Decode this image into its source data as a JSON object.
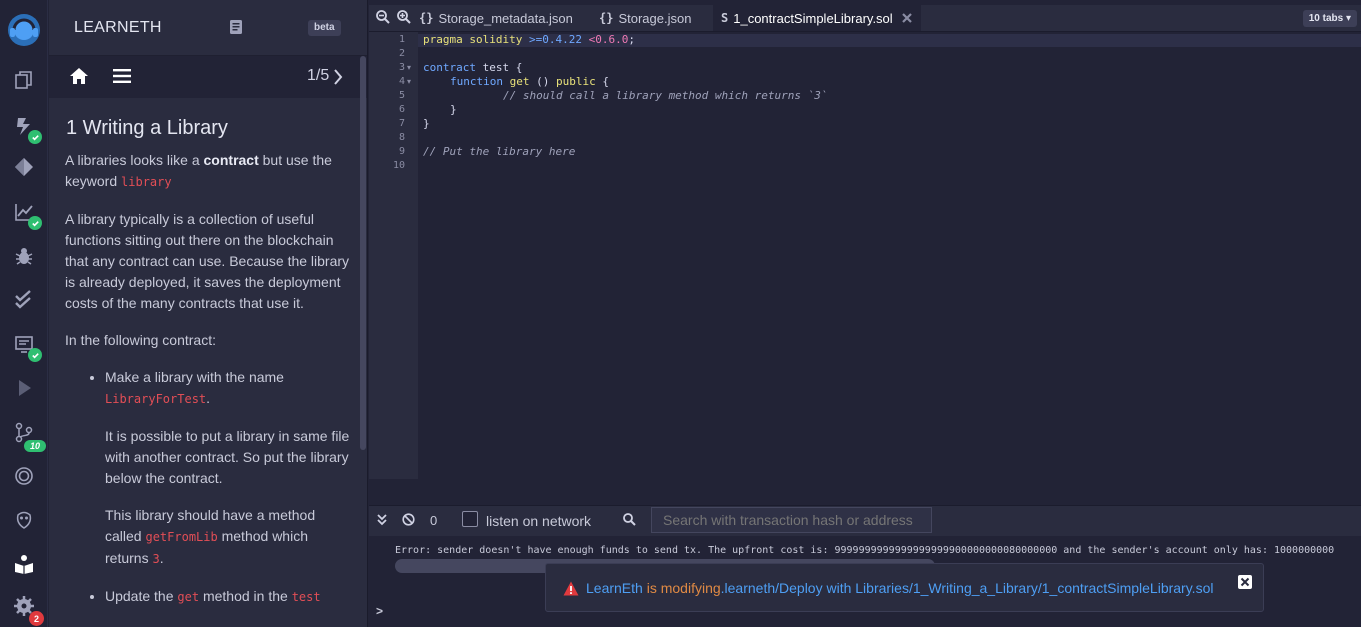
{
  "sidepanel": {
    "title": "LEARNETH",
    "beta": "beta",
    "step": "1/5",
    "heading": "1 Writing a Library",
    "p1_a": "A libraries looks like a ",
    "p1_b": "contract",
    "p1_c": " but use the keyword ",
    "p1_code": "library",
    "p2": "A library typically is a collection of useful functions sitting out there on the blockchain that any contract can use. Because the library is already deployed, it saves the deployment costs of the many contracts that use it.",
    "p3": "In the following contract:",
    "li1_a": "Make a library with the name ",
    "li1_code": "LibraryForTest",
    "li1_c": ".",
    "li1_p2": "It is possible to put a library in same file with another contract. So put the library below the contract.",
    "li1_p3_a": "This library should have a method called ",
    "li1_p3_code": "getFromLib",
    "li1_p3_c": " method which returns ",
    "li1_p3_code2": "3",
    "li1_p3_d": ".",
    "li2_a": "Update the ",
    "li2_code": "get",
    "li2_b": " method in the ",
    "li2_code2": "test"
  },
  "tabs": {
    "items": [
      {
        "icon": "{}",
        "label": "Storage_metadata.json"
      },
      {
        "icon": "{}",
        "label": "Storage.json"
      },
      {
        "icon": "S",
        "label": "1_contractSimpleLibrary.sol"
      }
    ],
    "count": "10 tabs ▾"
  },
  "iconbar": {
    "badge_git": "10",
    "badge_settings": "2"
  },
  "editor": {
    "lines": [
      "1",
      "2",
      "3",
      "4",
      "5",
      "6",
      "7",
      "8",
      "9",
      "10"
    ],
    "l1_kw": "pragma solidity ",
    "l1_ver1": ">=0.4.22",
    "l1_sp": " ",
    "l1_ver2": "<0.6.0",
    "l1_end": ";",
    "l3_kw": "contract",
    "l3_rest": " test {",
    "l4_kw": "function",
    "l4_name": " get",
    "l4_mid": " () ",
    "l4_pub": "public",
    "l4_end": " {",
    "l5": "// should call a library method which returns `3`",
    "l6": "}",
    "l7": "}",
    "l9": "// Put the library here"
  },
  "terminal": {
    "count": "0",
    "listen": "listen on network",
    "search_placeholder": "Search with transaction hash or address",
    "error": "Error: sender doesn't have enough funds to send tx. The upfront cost is: 9999999999999999999900000000080000000 and the sender's account only has: 1000000000",
    "prompt": ">"
  },
  "toast": {
    "app": "LearnEth",
    "verb": " is modifying",
    "path": ".learneth/Deploy with Libraries/1_Writing_a_Library/1_contractSimpleLibrary.sol"
  },
  "colors": {
    "background": "#222336",
    "panel": "#2a2c3f",
    "success": "#2fbf71",
    "danger": "#e03a3e",
    "link": "#4e9ff4",
    "warning": "#e08a44"
  }
}
